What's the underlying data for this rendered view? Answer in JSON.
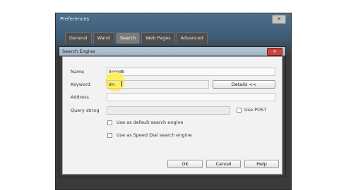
{
  "preferences": {
    "title": "Preferences",
    "close_label": "✕",
    "tabs": [
      "General",
      "Wand",
      "Search",
      "Web Pages",
      "Advanced"
    ],
    "active_tab": "Search"
  },
  "dialog": {
    "title": "Search Engine",
    "close_label": "✕",
    "name_label": "Name",
    "name_value": "Ilomdb",
    "keyword_label": "Keyword",
    "keyword_value": "im",
    "details_button": "Details <<",
    "address_label": "Address",
    "address_value": "",
    "query_label": "Query string",
    "query_value": "",
    "use_post_label": "Use POST",
    "default_engine_label": "Use as default search engine",
    "speed_dial_label": "Use as Speed Dial search engine",
    "ok_label": "OK",
    "cancel_label": "Cancel",
    "help_label": "Help"
  },
  "colors": {
    "highlight": "#fff046",
    "dialog_close": "#c8453a"
  }
}
